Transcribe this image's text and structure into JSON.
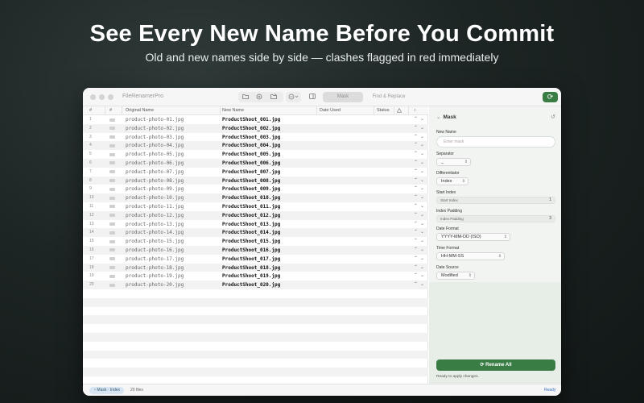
{
  "hero": {
    "title": "See Every New Name Before You Commit",
    "subtitle": "Old and new names side by side — clashes flagged in red immediately"
  },
  "window": {
    "app_title": "FileRenamerPro",
    "toolbar": {
      "icons": [
        "folder-icon",
        "add-icon",
        "folder-open-icon",
        "more-options-icon",
        "sidebar-toggle-icon"
      ],
      "segments": [
        "Mask",
        "Find & Replace"
      ],
      "active_segment": "Mask",
      "refresh_glyph": "⟳"
    }
  },
  "table": {
    "columns": [
      "#",
      "Original Name",
      "New Name",
      "Date Used",
      "Status"
    ],
    "rows": [
      {
        "num": "1",
        "original": "product-photo-01.jpg",
        "new": "ProductShoot_001.jpg"
      },
      {
        "num": "2",
        "original": "product-photo-02.jpg",
        "new": "ProductShoot_002.jpg"
      },
      {
        "num": "3",
        "original": "product-photo-03.jpg",
        "new": "ProductShoot_003.jpg"
      },
      {
        "num": "4",
        "original": "product-photo-04.jpg",
        "new": "ProductShoot_004.jpg"
      },
      {
        "num": "5",
        "original": "product-photo-05.jpg",
        "new": "ProductShoot_005.jpg"
      },
      {
        "num": "6",
        "original": "product-photo-06.jpg",
        "new": "ProductShoot_006.jpg"
      },
      {
        "num": "7",
        "original": "product-photo-07.jpg",
        "new": "ProductShoot_007.jpg"
      },
      {
        "num": "8",
        "original": "product-photo-08.jpg",
        "new": "ProductShoot_008.jpg"
      },
      {
        "num": "9",
        "original": "product-photo-09.jpg",
        "new": "ProductShoot_009.jpg"
      },
      {
        "num": "10",
        "original": "product-photo-10.jpg",
        "new": "ProductShoot_010.jpg"
      },
      {
        "num": "11",
        "original": "product-photo-11.jpg",
        "new": "ProductShoot_011.jpg"
      },
      {
        "num": "12",
        "original": "product-photo-12.jpg",
        "new": "ProductShoot_012.jpg"
      },
      {
        "num": "13",
        "original": "product-photo-13.jpg",
        "new": "ProductShoot_013.jpg"
      },
      {
        "num": "14",
        "original": "product-photo-14.jpg",
        "new": "ProductShoot_014.jpg"
      },
      {
        "num": "15",
        "original": "product-photo-15.jpg",
        "new": "ProductShoot_015.jpg"
      },
      {
        "num": "16",
        "original": "product-photo-16.jpg",
        "new": "ProductShoot_016.jpg"
      },
      {
        "num": "17",
        "original": "product-photo-17.jpg",
        "new": "ProductShoot_017.jpg"
      },
      {
        "num": "18",
        "original": "product-photo-18.jpg",
        "new": "ProductShoot_018.jpg"
      },
      {
        "num": "19",
        "original": "product-photo-19.jpg",
        "new": "ProductShoot_019.jpg"
      },
      {
        "num": "20",
        "original": "product-photo-20.jpg",
        "new": "ProductShoot_020.jpg"
      }
    ]
  },
  "panel": {
    "title": "Mask",
    "new_name": {
      "label": "New Name",
      "placeholder": "Enter mask"
    },
    "separator": {
      "label": "Separator",
      "value": "_"
    },
    "differentiator": {
      "label": "Differentiator",
      "value": "Index"
    },
    "start_index": {
      "label": "Start Index",
      "field_label": "Start Index",
      "value": "1"
    },
    "index_padding": {
      "label": "Index Padding",
      "field_label": "Index Padding",
      "value": "3"
    },
    "date_format": {
      "label": "Date Format",
      "value": "YYYY-MM-DD (ISO)"
    },
    "time_format": {
      "label": "Time Format",
      "value": "HH-MM-SS"
    },
    "date_source": {
      "label": "Date Source",
      "value": "Modified"
    },
    "rename_button": "Rename All",
    "status_message": "Ready to apply changes."
  },
  "statusbar": {
    "mode": "Mask · Index",
    "file_count": "20 files",
    "state": "Ready"
  },
  "colors": {
    "accent_green": "#3a7d44",
    "status_blue": "#3a72c4"
  }
}
